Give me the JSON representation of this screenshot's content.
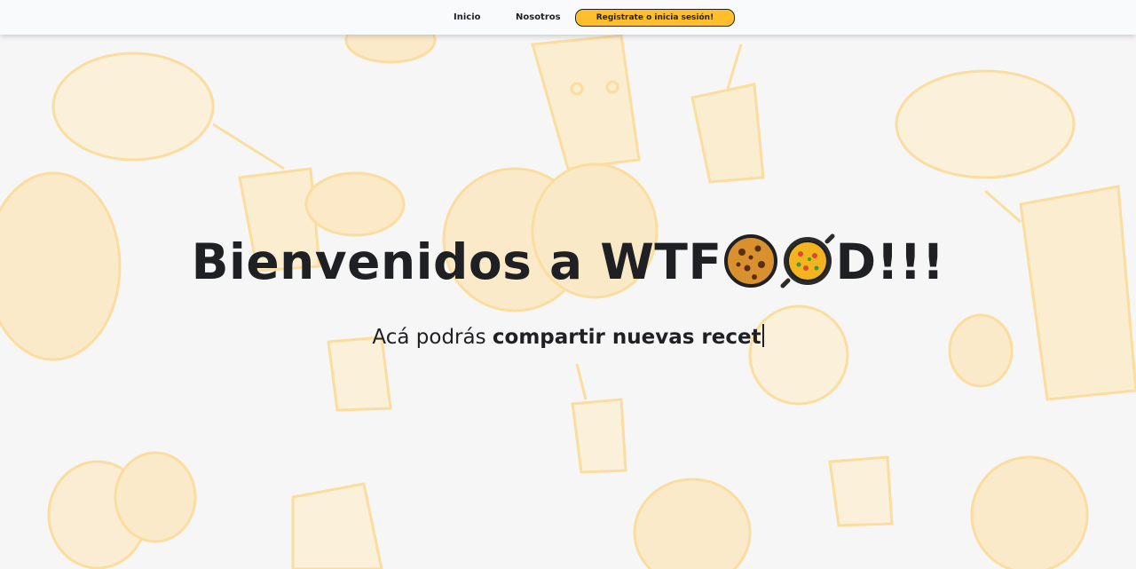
{
  "nav": {
    "links": [
      {
        "label": "Inicio"
      },
      {
        "label": "Nosotros"
      }
    ],
    "cta_label": "Registrate o inicia sesión!"
  },
  "hero": {
    "title_before": "Bienvenidos a WTF",
    "title_after": "D!!!",
    "title_emojis": [
      "cookie-icon",
      "paella-icon"
    ],
    "subtitle_prefix": "Acá podrás ",
    "subtitle_typed": "compartir nuevas recet"
  },
  "colors": {
    "accent": "#ffbf2d",
    "text": "#1f2023",
    "background": "#f7f6f7",
    "illustration": "#ffcf6a"
  }
}
